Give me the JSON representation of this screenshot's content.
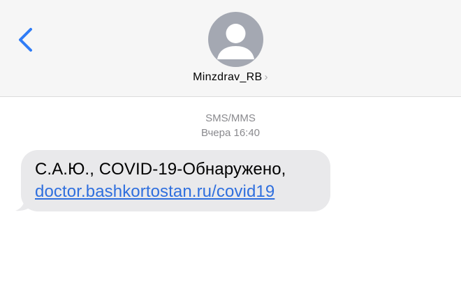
{
  "header": {
    "contact_name": "Minzdrav_RB",
    "chevron": "›",
    "back_icon": "chevron-left-icon",
    "avatar_icon": "person-silhouette-icon"
  },
  "thread": {
    "service": "SMS/MMS",
    "timestamp": "Вчера 16:40"
  },
  "message": {
    "text": "С.А.Ю., COVID-19-Обнаружено,",
    "link": "doctor.bashkortostan.ru/covid19"
  },
  "colors": {
    "accent": "#2f6fde",
    "bubble": "#e9e9eb",
    "header_bg": "#f6f6f6",
    "avatar": "#a4a8b2",
    "meta_text": "#8a8a8e"
  }
}
